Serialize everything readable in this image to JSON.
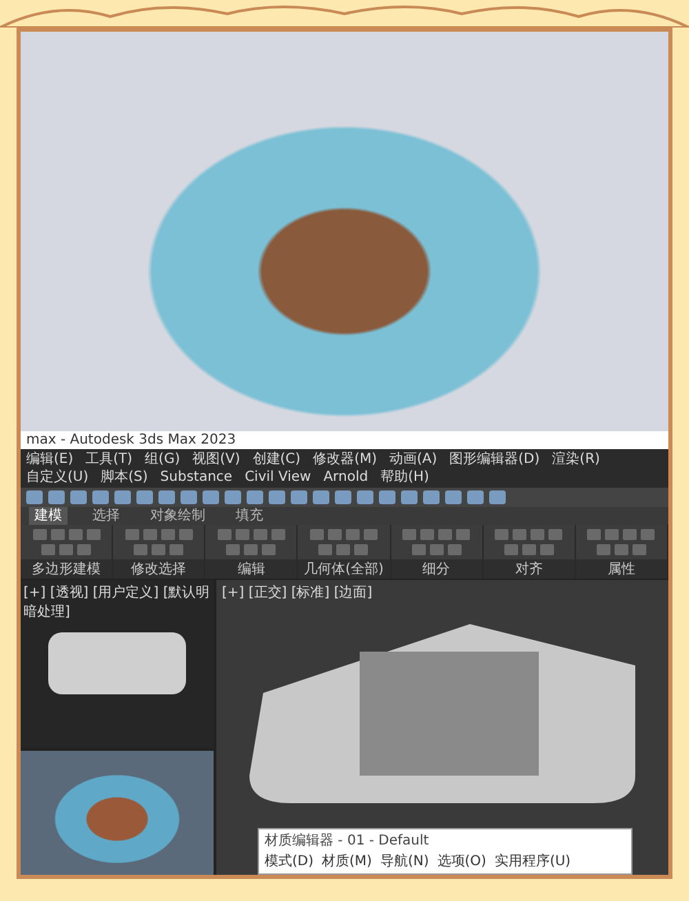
{
  "window": {
    "title": "max - Autodesk 3ds Max 2023"
  },
  "menu_bar": [
    "编辑(E)",
    "工具(T)",
    "组(G)",
    "视图(V)",
    "创建(C)",
    "修改器(M)",
    "动画(A)",
    "图形编辑器(D)",
    "渲染(R)",
    "自定义(U)",
    "脚本(S)",
    "Substance",
    "Civil View",
    "Arnold",
    "帮助(H)"
  ],
  "ribbon_tabs": [
    {
      "label": "建模",
      "selected": true
    },
    {
      "label": "选择",
      "selected": false
    },
    {
      "label": "对象绘制",
      "selected": false
    },
    {
      "label": "填充",
      "selected": false
    }
  ],
  "ribbon_groups": [
    "多边形建模",
    "修改选择",
    "编辑",
    "几何体(全部)",
    "细分",
    "对齐",
    "属性"
  ],
  "viewports": [
    {
      "label": "[+] [透视] [用户定义] [默认明暗处理]"
    },
    {
      "label": "[+] [正交] [标准] [边面]"
    }
  ],
  "material_editor": {
    "title": "材质编辑器 - 01 - Default",
    "menu": [
      "模式(D)",
      "材质(M)",
      "导航(N)",
      "选项(O)",
      "实用程序(U)"
    ]
  }
}
